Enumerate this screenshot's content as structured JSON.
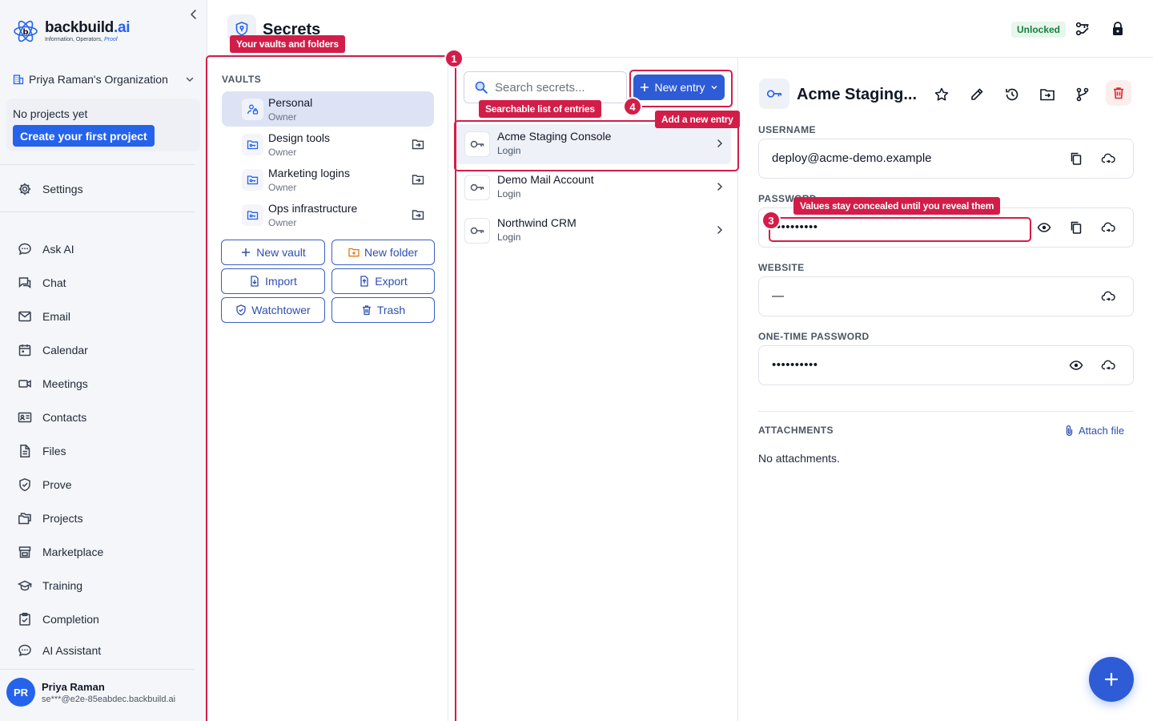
{
  "brand": {
    "name_main": "backbuild",
    "name_suffix": ".ai",
    "tagline": "Information, Operators,",
    "tagline_proof": "Proof"
  },
  "sidebar": {
    "org_name": "Priya Raman's Organization",
    "projects_empty": "No projects yet",
    "create_project_label": "Create your first project",
    "settings_label": "Settings",
    "nav": [
      {
        "label": "Ask AI",
        "icon": "chat-bubble-icon"
      },
      {
        "label": "Chat",
        "icon": "chat-icon"
      },
      {
        "label": "Email",
        "icon": "mail-icon"
      },
      {
        "label": "Calendar",
        "icon": "calendar-icon"
      },
      {
        "label": "Meetings",
        "icon": "video-icon"
      },
      {
        "label": "Contacts",
        "icon": "contact-card-icon"
      },
      {
        "label": "Files",
        "icon": "file-icon"
      },
      {
        "label": "Prove",
        "icon": "shield-check-icon"
      },
      {
        "label": "Projects",
        "icon": "folders-icon"
      },
      {
        "label": "Marketplace",
        "icon": "store-icon"
      },
      {
        "label": "Training",
        "icon": "graduation-cap-icon"
      },
      {
        "label": "Completion",
        "icon": "clipboard-check-icon"
      },
      {
        "label": "AI Assistant",
        "icon": "chat-bubble-icon"
      }
    ],
    "user": {
      "initials": "PR",
      "name": "Priya Raman",
      "email": "se***@e2e-85eabdec.backbuild.ai"
    }
  },
  "header": {
    "title": "Secrets",
    "status": "Unlocked",
    "status_color": "#16803c"
  },
  "vaults": {
    "section_label": "VAULTS",
    "items": [
      {
        "name": "Personal",
        "role": "Owner",
        "selected": true
      },
      {
        "name": "Design tools",
        "role": "Owner"
      },
      {
        "name": "Marketing logins",
        "role": "Owner"
      },
      {
        "name": "Ops infrastructure",
        "role": "Owner"
      }
    ],
    "buttons": {
      "new_vault": "New vault",
      "new_folder": "New folder",
      "import": "Import",
      "export": "Export",
      "watchtower": "Watchtower",
      "trash": "Trash"
    }
  },
  "entries": {
    "search_placeholder": "Search secrets...",
    "new_entry_label": "New entry",
    "items": [
      {
        "name": "Acme Staging Console",
        "type": "Login",
        "selected": true
      },
      {
        "name": "Demo Mail Account",
        "type": "Login"
      },
      {
        "name": "Northwind CRM",
        "type": "Login"
      }
    ]
  },
  "detail": {
    "title": "Acme Staging...",
    "fields": {
      "username_label": "USERNAME",
      "username_value": "deploy@acme-demo.example",
      "password_label": "PASSWORD",
      "password_value": "••••••••••",
      "website_label": "WEBSITE",
      "website_value": "—",
      "otp_label": "ONE-TIME PASSWORD",
      "otp_value": "••••••••••"
    },
    "attachments_label": "ATTACHMENTS",
    "attach_file_label": "Attach file",
    "no_attachments": "No attachments."
  },
  "annotations": {
    "n1": "1",
    "t1": "Your vaults and folders",
    "t2": "Searchable list of entries",
    "n3": "3",
    "t3": "Values stay concealed until you reveal them",
    "n4": "4",
    "t4": "Add a new entry",
    "accent": "#d31d48"
  }
}
